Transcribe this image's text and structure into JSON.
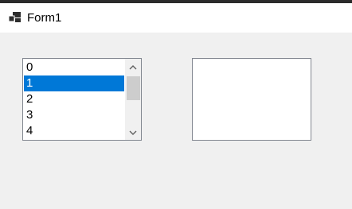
{
  "window": {
    "title": "Form1",
    "icon": "form-window-icon"
  },
  "listbox": {
    "items": [
      "0",
      "1",
      "2",
      "3",
      "4"
    ],
    "selected_index": 1,
    "scroll_up_icon": "chevron-up-icon",
    "scroll_down_icon": "chevron-down-icon"
  },
  "colors": {
    "selection": "#0078d7",
    "border": "#828790",
    "background": "#f0f0f0"
  }
}
